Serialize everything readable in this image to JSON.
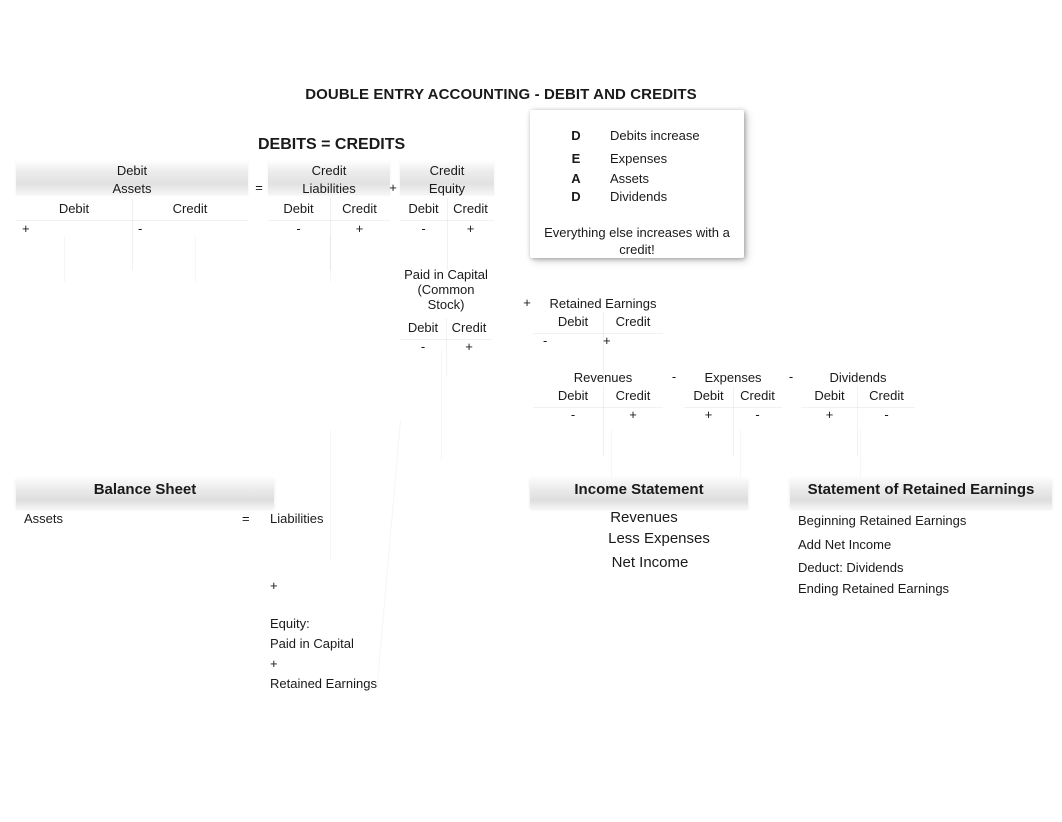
{
  "titles": {
    "main": "DOUBLE ENTRY ACCOUNTING - DEBIT AND CREDITS",
    "equation": "DEBITS = CREDITS"
  },
  "dead_box": {
    "rows": [
      {
        "key": "D",
        "value": "Debits increase"
      },
      {
        "key": "E",
        "value": "Expenses"
      },
      {
        "key": "A",
        "value": "Assets"
      },
      {
        "key": "D",
        "value": "Dividends"
      }
    ],
    "note": "Everything else increases with a credit!"
  },
  "operators": {
    "equals": "=",
    "plus": "+",
    "minus": "-"
  },
  "column_labels": {
    "debit": "Debit",
    "credit": "Credit"
  },
  "t_accounts": {
    "assets": {
      "normal_balance": "Debit",
      "name": "Assets",
      "columns": [
        "Debit",
        "Credit"
      ],
      "signs": [
        "+",
        "-"
      ]
    },
    "liabilities": {
      "normal_balance": "Credit",
      "name": "Liabilities",
      "columns": [
        "Debit",
        "Credit"
      ],
      "signs": [
        "-",
        "+"
      ]
    },
    "equity": {
      "normal_balance": "Credit",
      "name": "Equity",
      "columns": [
        "Debit",
        "Credit"
      ],
      "signs": [
        "-",
        "+"
      ]
    },
    "paid_in_capital": {
      "name_line1": "Paid in Capital",
      "name_line2": "(Common",
      "name_line3": "Stock)",
      "columns": [
        "Debit",
        "Credit"
      ],
      "signs": [
        "-",
        "+"
      ]
    },
    "retained_earnings": {
      "name": "Retained Earnings",
      "columns": [
        "Debit",
        "Credit"
      ],
      "signs": [
        "-",
        "+"
      ]
    },
    "revenues": {
      "name": "Revenues",
      "columns": [
        "Debit",
        "Credit"
      ],
      "signs": [
        "-",
        "+"
      ]
    },
    "expenses": {
      "name": "Expenses",
      "columns": [
        "Debit",
        "Credit"
      ],
      "signs": [
        "+",
        "-"
      ]
    },
    "dividends": {
      "name": "Dividends",
      "columns": [
        "Debit",
        "Credit"
      ],
      "signs": [
        "+",
        "-"
      ]
    }
  },
  "statements": {
    "balance_sheet": {
      "title": "Balance Sheet",
      "left": [
        "Assets"
      ],
      "equals": "=",
      "right": [
        "Liabilities",
        "+",
        "Equity:",
        "Paid in Capital",
        "+",
        "Retained Earnings"
      ]
    },
    "income_statement": {
      "title": "Income Statement",
      "lines": [
        "Revenues",
        "Less Expenses",
        "Net Income"
      ]
    },
    "retained_earnings_statement": {
      "title": "Statement of Retained Earnings",
      "lines": [
        "Beginning Retained Earnings",
        "Add Net Income",
        "Deduct:  Dividends",
        "Ending Retained Earnings"
      ]
    }
  }
}
